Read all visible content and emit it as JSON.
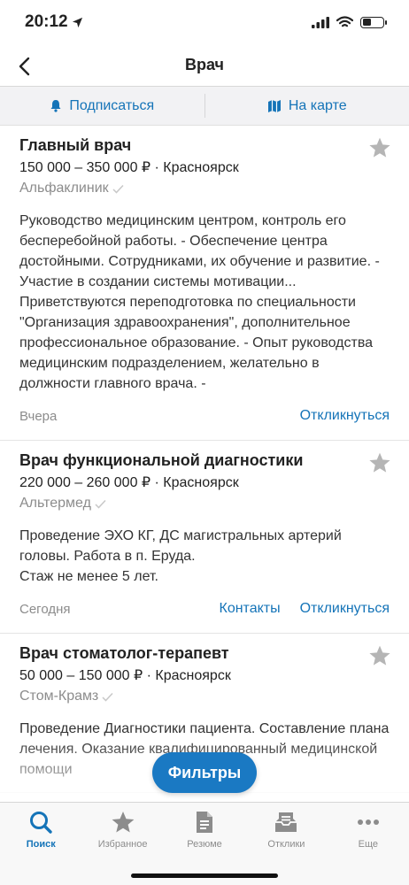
{
  "status": {
    "time": "20:12"
  },
  "nav": {
    "title": "Врач"
  },
  "actions": {
    "subscribe": "Подписаться",
    "map": "На карте"
  },
  "vacancies": [
    {
      "title": "Главный врач",
      "salary": "150 000 – 350 000 ₽ · Красноярск",
      "company": "Альфаклиник",
      "description": "Руководство медицинским центром, контроль его бесперебойной работы. - Обеспечение центра достойными. Сотрудниками, их обучение и развитие. - Участие в создании системы мотивации... Приветствуются переподготовка по специальности \"Организация здравоохранения\", дополнительное профессиональное образование. - Опыт руководства медицинским подразделением, желательно в должности главного врача. -",
      "date": "Вчера",
      "respond": "Откликнуться"
    },
    {
      "title": "Врач функциональной диагностики",
      "salary": "220 000 – 260 000 ₽ · Красноярск",
      "company": "Альтермед",
      "description_lines": [
        "Проведение ЭХО КГ, ДС магистральных артерий головы. Работа в п. Еруда.",
        "Стаж не менее 5 лет."
      ],
      "date": "Сегодня",
      "contacts": "Контакты",
      "respond": "Откликнуться"
    },
    {
      "title": "Врач стоматолог-терапевт",
      "salary": "50 000 – 150 000 ₽ · Красноярск",
      "company": "Стом-Крамз",
      "description": "Проведение Диагностики пациента. Составление плана лечения. Оказание квалифицированный медицинской помощи"
    }
  ],
  "filters": "Фильтры",
  "tabs": [
    {
      "label": "Поиск",
      "icon": "search-icon"
    },
    {
      "label": "Избранное",
      "icon": "star-icon"
    },
    {
      "label": "Резюме",
      "icon": "document-icon"
    },
    {
      "label": "Отклики",
      "icon": "inbox-icon"
    },
    {
      "label": "Еще",
      "icon": "more-icon"
    }
  ],
  "colors": {
    "accent": "#1574b8",
    "filters_bg": "#1a79c3",
    "muted": "#8c8c8c",
    "star": "#b5b5b5"
  }
}
